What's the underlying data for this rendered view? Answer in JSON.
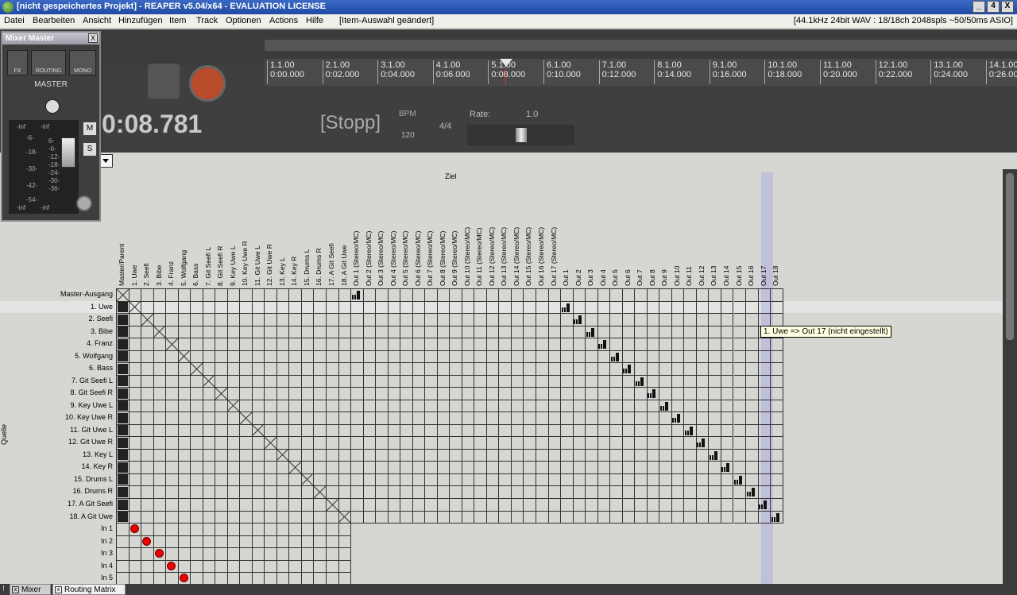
{
  "window": {
    "title": "[nicht gespeichertes Projekt] - REAPER v5.04/x64 - EVALUATION LICENSE",
    "min": "_",
    "max": "4",
    "close": "X"
  },
  "menu": {
    "items": [
      "Datei",
      "Bearbeiten",
      "Ansicht",
      "Hinzufügen",
      "Item",
      "Track",
      "Optionen",
      "Actions",
      "Hilfe"
    ],
    "status": "[Item-Auswahl geändert]",
    "audio_info": "[44.1kHz 24bit WAV : 18/18ch 2048spls ~50/50ms ASIO]"
  },
  "timeline": {
    "ticks": [
      {
        "bar": "1.1.00",
        "time": "0:00.000"
      },
      {
        "bar": "2.1.00",
        "time": "0:02.000"
      },
      {
        "bar": "3.1.00",
        "time": "0:04.000"
      },
      {
        "bar": "4.1.00",
        "time": "0:06.000"
      },
      {
        "bar": "5.1.00",
        "time": "0:08.000"
      },
      {
        "bar": "6.1.00",
        "time": "0:10.000"
      },
      {
        "bar": "7.1.00",
        "time": "0:12.000"
      },
      {
        "bar": "8.1.00",
        "time": "0:14.000"
      },
      {
        "bar": "9.1.00",
        "time": "0:16.000"
      },
      {
        "bar": "10.1.00",
        "time": "0:18.000"
      },
      {
        "bar": "11.1.00",
        "time": "0:20.000"
      },
      {
        "bar": "12.1.00",
        "time": "0:22.000"
      },
      {
        "bar": "13.1.00",
        "time": "0:24.000"
      },
      {
        "bar": "14.1.00",
        "time": "0:26.000"
      }
    ]
  },
  "transport": {
    "time": "0:08.781",
    "state": "[Stopp]",
    "bpm_label": "BPM",
    "bpm": "120",
    "signature": "4/4",
    "rate_label": "Rate:",
    "rate": "1.0"
  },
  "mixer": {
    "title": "Mixer Master",
    "close": "X",
    "fx": "FX",
    "routing": "ROUTING",
    "mono": "MONO",
    "name": "MASTER",
    "mute": "M",
    "solo": "S",
    "meter_top_left": "-inf",
    "meter_top_right": "-inf",
    "meter_bottom_left": "-inf",
    "meter_bottom_right": "-inf",
    "scale": [
      "-6-",
      "-18-",
      "-30-",
      "-42-",
      "-54-"
    ],
    "scale_right": [
      "6-",
      "-6-",
      "-12-",
      "-18-",
      "-24-",
      "-30-",
      "-36-"
    ]
  },
  "matrix": {
    "dest_label": "Ziel",
    "source_label": "Quelle",
    "columns": [
      "Master/Parent",
      "1. Uwe",
      "2. Seefi",
      "3. Bibe",
      "4. Franz",
      "5. Wolfgang",
      "6. Bass",
      "7. Git Seefi L",
      "8. Git Seefi R",
      "9. Key Uwe L",
      "10. Key Uwe R",
      "11. Git Uwe L",
      "12. Git Uwe R",
      "13. Key L",
      "14. Key R",
      "15. Drums L",
      "16. Drums R",
      "17. A Git Seefi",
      "18. A Git Uwe",
      "Out 1 (Stereo/MC)",
      "Out 2 (Stereo/MC)",
      "Out 3 (Stereo/MC)",
      "Out 4 (Stereo/MC)",
      "Out 5 (Stereo/MC)",
      "Out 6 (Stereo/MC)",
      "Out 7 (Stereo/MC)",
      "Out 8 (Stereo/MC)",
      "Out 9 (Stereo/MC)",
      "Out 10 (Stereo/MC)",
      "Out 11 (Stereo/MC)",
      "Out 12 (Stereo/MC)",
      "Out 13 (Stereo/MC)",
      "Out 14 (Stereo/MC)",
      "Out 15 (Stereo/MC)",
      "Out 16 (Stereo/MC)",
      "Out 17 (Stereo/MC)",
      "Out 1",
      "Out 2",
      "Out 3",
      "Out 4",
      "Out 5",
      "Out 6",
      "Out 7",
      "Out 8",
      "Out 9",
      "Out 10",
      "Out 11",
      "Out 12",
      "Out 13",
      "Out 14",
      "Out 15",
      "Out 16",
      "Out 17",
      "Out 18"
    ],
    "rows": [
      "Master-Ausgang",
      "1. Uwe",
      "2. Seefi",
      "3. Bibe",
      "4. Franz",
      "5. Wolfgang",
      "6. Bass",
      "7. Git Seefi L",
      "8. Git Seefi R",
      "9. Key Uwe L",
      "10. Key Uwe R",
      "11. Git Uwe L",
      "12. Git Uwe R",
      "13. Key L",
      "14. Key R",
      "15. Drums L",
      "16. Drums R",
      "17. A Git Seefi",
      "18. A Git Uwe"
    ],
    "inputs": [
      "In 1",
      "In 2",
      "In 3",
      "In 4",
      "In 5"
    ],
    "tooltip": "1. Uwe => Out 17 (nicht eingestellt)"
  },
  "bottom_tabs": {
    "bang": "!",
    "mixer": "Mixer",
    "routing": "Routing Matrix"
  },
  "colors": {
    "title_bar": "#2a55b5",
    "dark_panel": "#3b3b3b",
    "grid_bg": "#d6d7d3",
    "input_active": "#e00000"
  }
}
